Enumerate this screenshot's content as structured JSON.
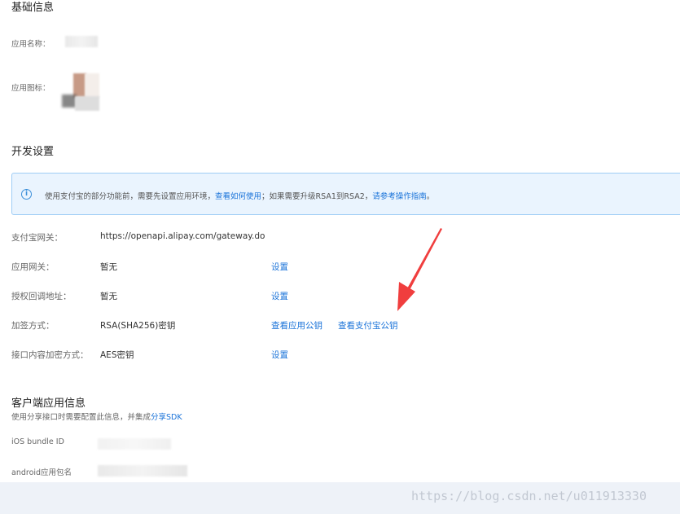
{
  "basic_info": {
    "title": "基础信息",
    "app_name_label": "应用名称：",
    "app_icon_label": "应用图标："
  },
  "dev_settings": {
    "title": "开发设置",
    "notice": {
      "text_before": "使用支付宝的部分功能前，需要先设置应用环境，",
      "link1": "查看如何使用",
      "text_middle": "；如果需要升级RSA1到RSA2，",
      "link2": "请参考操作指南",
      "text_end": "。"
    },
    "rows": [
      {
        "label": "支付宝网关：",
        "value": "https://openapi.alipay.com/gateway.do"
      },
      {
        "label": "应用网关：",
        "value": "暂无",
        "action": "设置"
      },
      {
        "label": "授权回调地址：",
        "value": "暂无",
        "action": "设置"
      },
      {
        "label": "加签方式：",
        "value": "RSA(SHA256)密钥",
        "action": "查看应用公钥",
        "action2": "查看支付宝公钥"
      },
      {
        "label": "接口内容加密方式：",
        "value": "AES密钥",
        "action": "设置"
      }
    ]
  },
  "client_info": {
    "title": "客户端应用信息",
    "desc_before": "使用分享接口时需要配置此信息，并集成",
    "desc_link": "分享SDK",
    "ios_label": "iOS bundle ID",
    "android_label": "android应用包名"
  },
  "watermark": "https://blog.csdn.net/u011913330",
  "colors": {
    "link": "#1a73d9",
    "notice_bg": "#eaf4fe",
    "notice_border": "#9fcdf5",
    "arrow": "#f03e3e"
  }
}
